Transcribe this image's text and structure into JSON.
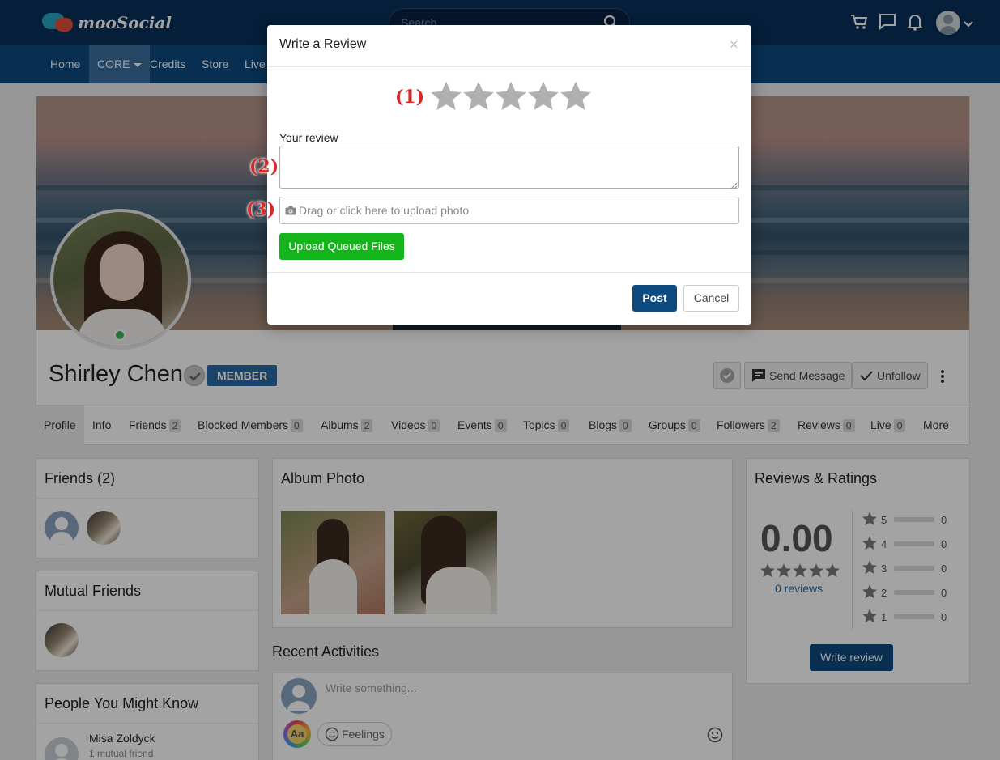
{
  "header": {
    "logo_text": "mooSocial",
    "search_placeholder": "Search",
    "icons": [
      "cart-icon",
      "chat-icon",
      "bell-icon",
      "avatar",
      "chevron-down-icon"
    ]
  },
  "nav": {
    "items": [
      {
        "label": "Home"
      },
      {
        "label": "CORE"
      },
      {
        "label": "Credits"
      },
      {
        "label": "Store"
      },
      {
        "label": "Live"
      }
    ]
  },
  "profile": {
    "name": "Shirley Chen",
    "role_badge": "MEMBER",
    "send_message": "Send Message",
    "unfollow": "Unfollow",
    "online": true
  },
  "tabs": [
    {
      "label": "Profile",
      "count": null
    },
    {
      "label": "Info",
      "count": null
    },
    {
      "label": "Friends",
      "count": "2"
    },
    {
      "label": "Blocked Members",
      "count": "0"
    },
    {
      "label": "Albums",
      "count": "2"
    },
    {
      "label": "Videos",
      "count": "0"
    },
    {
      "label": "Events",
      "count": "0"
    },
    {
      "label": "Topics",
      "count": "0"
    },
    {
      "label": "Blogs",
      "count": "0"
    },
    {
      "label": "Groups",
      "count": "0"
    },
    {
      "label": "Followers",
      "count": "2"
    },
    {
      "label": "Reviews",
      "count": "0"
    },
    {
      "label": "Live",
      "count": "0"
    },
    {
      "label": "More",
      "count": null
    }
  ],
  "left": {
    "friends_title": "Friends (2)",
    "mutual_title": "Mutual Friends",
    "pymk_title": "People You Might Know",
    "pymk_name": "Misa Zoldyck",
    "pymk_sub": "1 mutual friend"
  },
  "center": {
    "album_title": "Album Photo",
    "recent_title": "Recent Activities",
    "composer_placeholder": "Write something...",
    "aa_label": "Aa",
    "feelings_label": "Feelings"
  },
  "ratings": {
    "title": "Reviews & Ratings",
    "score": "0.00",
    "reviews_link": "0 reviews",
    "rows": [
      {
        "stars": "5",
        "count": "0",
        "fraction": 0
      },
      {
        "stars": "4",
        "count": "0",
        "fraction": 0
      },
      {
        "stars": "3",
        "count": "0",
        "fraction": 0
      },
      {
        "stars": "2",
        "count": "0",
        "fraction": 0
      },
      {
        "stars": "1",
        "count": "0",
        "fraction": 0
      }
    ],
    "write_review": "Write review"
  },
  "modal": {
    "title": "Write a Review",
    "close": "×",
    "annotation_1": "(1)",
    "annotation_2": "(2)",
    "annotation_3": "(3)",
    "star_count": 5,
    "review_label": "Your review",
    "review_value": "",
    "upload_placeholder": "Drag or click here to upload photo",
    "upload_button": "Upload Queued Files",
    "post": "Post",
    "cancel": "Cancel"
  },
  "colors": {
    "header_bg": "#08305a",
    "nav_bg": "#0d4a7f",
    "accent": "#0d4a7f",
    "badge": "#2a6aa7",
    "upload_green": "#13b51a",
    "annotation_red": "#d62a2a",
    "online_green": "#3fb45a",
    "star_gray": "#b0b0b0"
  }
}
